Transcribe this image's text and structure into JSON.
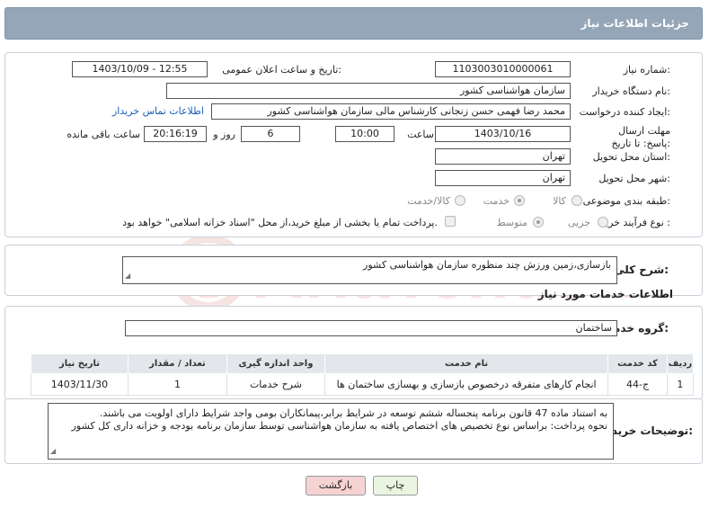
{
  "header": {
    "title": "جزئیات اطلاعات نیاز"
  },
  "form": {
    "need_number_label": "شماره نیاز:",
    "need_number": "1103003010000061",
    "announce_label": "تاریخ و ساعت اعلان عمومی:",
    "announce_value": "1403/10/09 - 12:55",
    "buyer_org_label": "نام دستگاه خریدار:",
    "buyer_org": "سازمان هواشناسی کشور",
    "creator_label": "ایجاد کننده درخواست:",
    "creator": "محمد رضا فهمی حسن زنجانی کارشناس مالی سازمان هواشناسی کشور",
    "contact_link": "اطلاعات تماس خریدار",
    "deadline_label": "مهلت ارسال پاسخ: تا تاریخ:",
    "deadline_date": "1403/10/16",
    "time_label": "ساعت",
    "deadline_time": "10:00",
    "days_value": "6",
    "days_label": "روز و",
    "remaining_time": "20:16:19",
    "remaining_label": "ساعت باقی مانده",
    "province_label": "استان محل تحویل:",
    "province": "تهران",
    "city_label": "شهر محل تحویل:",
    "city": "تهران",
    "category_label": "طبقه بندی موضوعی:",
    "category_options": [
      "کالا",
      "خدمت",
      "کالا/خدمت"
    ],
    "category_selected": "خدمت",
    "process_label": "نوع فرآیند خرید :",
    "process_options": [
      "جزیی",
      "متوسط"
    ],
    "process_selected": "متوسط",
    "payment_note": "پرداخت تمام یا بخشی از مبلغ خرید،از محل \"اسناد خزانه اسلامی\" خواهد بود."
  },
  "description": {
    "label": "شرح کلی نیاز:",
    "text": "بازسازی،زمین ورزش چند منظوره سازمان هواشناسی کشور"
  },
  "services": {
    "section_title": "اطلاعات خدمات مورد نیاز",
    "group_label": "گروه خدمت:",
    "group_value": "ساختمان",
    "columns": [
      "ردیف",
      "کد خدمت",
      "نام خدمت",
      "واحد اندازه گیری",
      "تعداد / مقدار",
      "تاریخ نیاز"
    ],
    "rows": [
      [
        "1",
        "ج-44",
        "انجام کارهای متفرقه درخصوص بازسازی و بهسازی ساختمان ها",
        "شرح خدمات",
        "1",
        "1403/11/30"
      ]
    ]
  },
  "buyer_notes": {
    "label": "توضیحات خریدار:",
    "line1": "به استناد ماده 47 قانون برنامه پنجساله ششم توسعه در شرایط برابر،پیمانکاران بومی واجد شرایط دارای اولویت می باشند.",
    "line2": "نحوه پرداخت: براساس نوع تخصیص های اختصاص یافته به سازمان هواشناسی توسط سازمان برنامه بودجه و خزانه داری کل کشور"
  },
  "buttons": {
    "print": "چاپ",
    "back": "بازگشت"
  },
  "watermark": {
    "text": "AriaTender.neT"
  },
  "colors": {
    "titlebar": "#95a6b8",
    "back_button": "#f6d3d3",
    "print_button": "#e9f5e1",
    "link": "#1a5fb4"
  }
}
